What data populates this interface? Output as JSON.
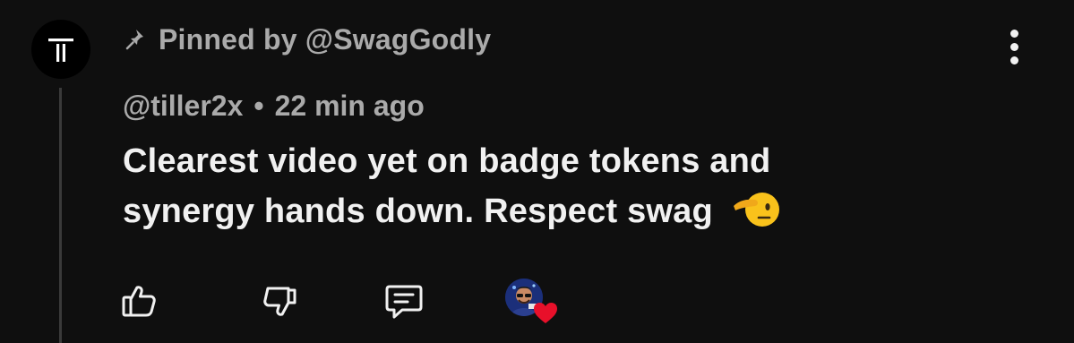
{
  "pinned": {
    "text": "Pinned by @SwagGodly",
    "icon": "pin-icon"
  },
  "comment": {
    "author": "@tiller2x",
    "separator": "•",
    "time": "22 min ago",
    "body": "Clearest video yet on badge tokens and synergy hands down. Respect swag",
    "emoji": "saluting-face-emoji",
    "avatar_icon": "channel-logo-icon"
  },
  "actions": {
    "like_icon": "thumbs-up-icon",
    "dislike_icon": "thumbs-down-icon",
    "reply_icon": "reply-comment-icon",
    "creator_heart": "creator-heart-icon",
    "menu_icon": "more-vertical-icon"
  },
  "colors": {
    "background": "#0f0f0f",
    "primary_text": "#f1f1f1",
    "secondary_text": "#aaaaaa",
    "heart": "#e8102a"
  }
}
